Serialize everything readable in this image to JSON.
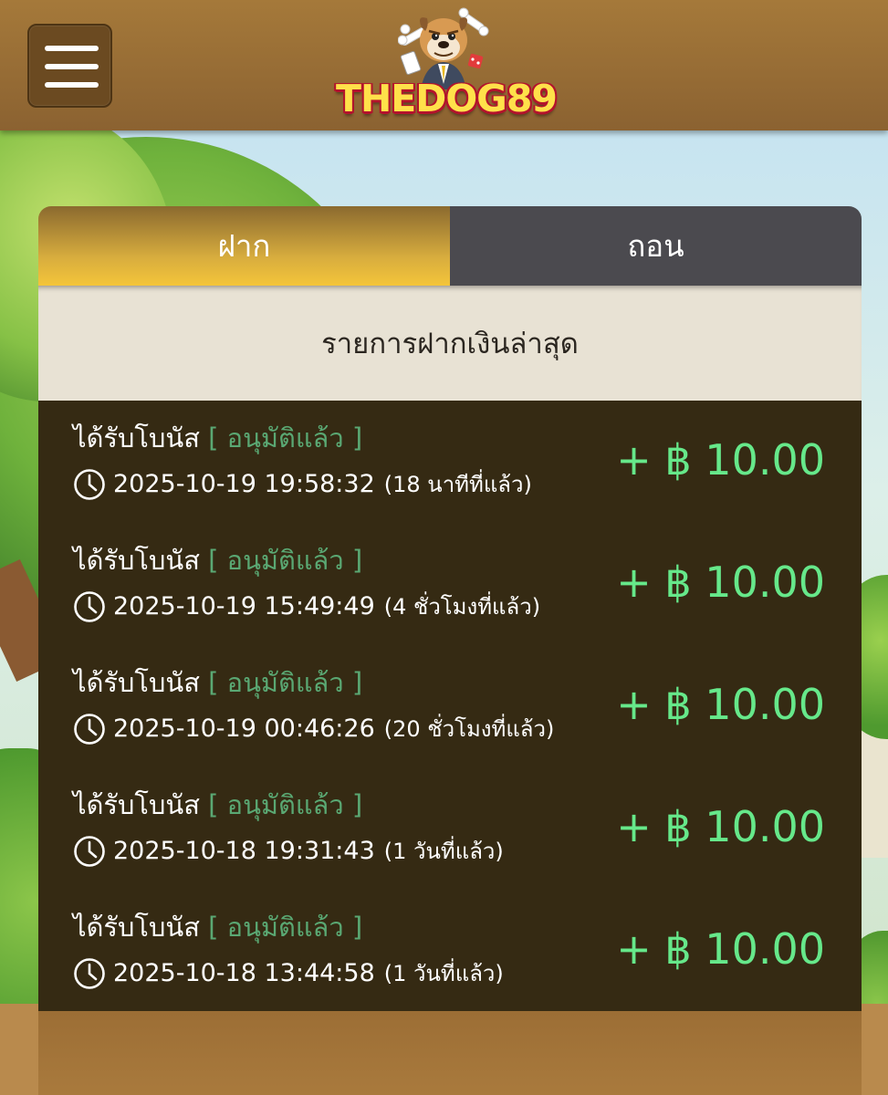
{
  "header": {
    "menu_icon": "hamburger-menu-icon",
    "logo_text": "THEDOG89"
  },
  "tabs": [
    {
      "label": "ฝาก",
      "active": true
    },
    {
      "label": "ถอน",
      "active": false
    }
  ],
  "list": {
    "title": "รายการฝากเงินล่าสุด",
    "items": [
      {
        "type": "ได้รับโบนัส",
        "status": "[ อนุมัติแล้ว ]",
        "datetime": "2025-10-19 19:58:32",
        "ago": "(18 นาทีที่แล้ว)",
        "amount": "+ ฿ 10.00"
      },
      {
        "type": "ได้รับโบนัส",
        "status": "[ อนุมัติแล้ว ]",
        "datetime": "2025-10-19 15:49:49",
        "ago": "(4 ชั่วโมงที่แล้ว)",
        "amount": "+ ฿ 10.00"
      },
      {
        "type": "ได้รับโบนัส",
        "status": "[ อนุมัติแล้ว ]",
        "datetime": "2025-10-19 00:46:26",
        "ago": "(20 ชั่วโมงที่แล้ว)",
        "amount": "+ ฿ 10.00"
      },
      {
        "type": "ได้รับโบนัส",
        "status": "[ อนุมัติแล้ว ]",
        "datetime": "2025-10-18 19:31:43",
        "ago": "(1 วันที่แล้ว)",
        "amount": "+ ฿ 10.00"
      },
      {
        "type": "ได้รับโบนัส",
        "status": "[ อนุมัติแล้ว ]",
        "datetime": "2025-10-18 13:44:58",
        "ago": "(1 วันที่แล้ว)",
        "amount": "+ ฿ 10.00"
      }
    ]
  },
  "colors": {
    "header_bg": "#9a6f36",
    "tab_active": "#f4c53a",
    "tab_inactive": "#4b4a4f",
    "list_bg": "#352a13",
    "status_green": "#5aa873",
    "amount_green": "#66e88a"
  }
}
